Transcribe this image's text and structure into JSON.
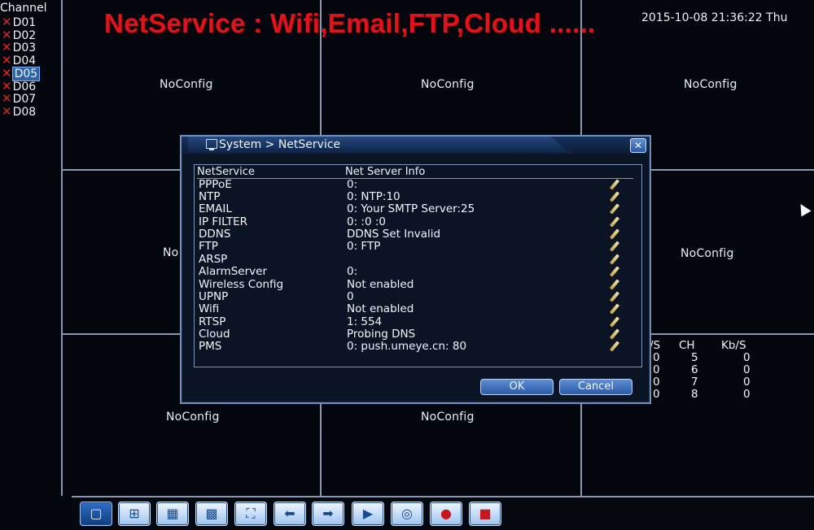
{
  "overlay_title": "NetService : Wifi,Email,FTP,Cloud ......",
  "datetime": "2015-10-08 21:36:22 Thu",
  "channel_panel": {
    "heading": "Channel",
    "channels": [
      {
        "label": "D01",
        "selected": false
      },
      {
        "label": "D02",
        "selected": false
      },
      {
        "label": "D03",
        "selected": false
      },
      {
        "label": "D04",
        "selected": false
      },
      {
        "label": "D05",
        "selected": true
      },
      {
        "label": "D06",
        "selected": false
      },
      {
        "label": "D07",
        "selected": false
      },
      {
        "label": "D08",
        "selected": false
      }
    ],
    "status_icon": "red-x-icon"
  },
  "panes": {
    "noconfig_label": "NoConfig",
    "partial_label": "No"
  },
  "stats": {
    "headers": [
      "/S",
      "CH",
      "Kb/S"
    ],
    "rows": [
      [
        "0",
        "5",
        "0"
      ],
      [
        "0",
        "6",
        "0"
      ],
      [
        "0",
        "7",
        "0"
      ],
      [
        "0",
        "8",
        "0"
      ]
    ]
  },
  "dialog": {
    "title": "System > NetService",
    "title_icon": "monitor-icon",
    "close_icon": "close-icon",
    "columns": [
      "NetService",
      "Net Server Info"
    ],
    "rows": [
      {
        "name": "PPPoE",
        "info": "0:"
      },
      {
        "name": "NTP",
        "info": "0: NTP:10"
      },
      {
        "name": "EMAIL",
        "info": "0: Your SMTP Server:25"
      },
      {
        "name": "IP FILTER",
        "info": "0: :0 :0"
      },
      {
        "name": "DDNS",
        "info": "DDNS Set Invalid"
      },
      {
        "name": "FTP",
        "info": "0: FTP"
      },
      {
        "name": "ARSP",
        "info": ""
      },
      {
        "name": "AlarmServer",
        "info": "0:"
      },
      {
        "name": "Wireless Config",
        "info": "Not enabled"
      },
      {
        "name": "UPNP",
        "info": "0"
      },
      {
        "name": "Wifi",
        "info": "Not enabled"
      },
      {
        "name": "RTSP",
        "info": "1: 554"
      },
      {
        "name": "Cloud",
        "info": "Probing DNS"
      },
      {
        "name": "PMS",
        "info": "0: push.umeye.cn: 80"
      }
    ],
    "ok_label": "OK",
    "cancel_label": "Cancel"
  },
  "toolbar": {
    "buttons": [
      {
        "name": "single-view",
        "icon": "single-screen-icon",
        "active": true
      },
      {
        "name": "quad-view",
        "icon": "quad-screen-icon",
        "active": false
      },
      {
        "name": "nine-view",
        "icon": "nine-screen-icon",
        "active": false
      },
      {
        "name": "sixteen-view",
        "icon": "sixteen-screen-icon",
        "active": false
      },
      {
        "name": "full-view",
        "icon": "fullscreen-icon",
        "active": false
      },
      {
        "name": "previous",
        "icon": "arrow-left-icon",
        "active": false
      },
      {
        "name": "next",
        "icon": "arrow-right-icon",
        "active": false
      },
      {
        "name": "playback",
        "icon": "playback-icon",
        "active": false
      },
      {
        "name": "ptz",
        "icon": "ptz-icon",
        "active": false
      },
      {
        "name": "record",
        "icon": "record-icon",
        "active": false
      },
      {
        "name": "stop-record",
        "icon": "stop-record-icon",
        "active": false
      }
    ]
  },
  "colors": {
    "title_red": "#e0121a",
    "dialog_blue": "#2a5aa6",
    "x_red": "#e0261a"
  }
}
